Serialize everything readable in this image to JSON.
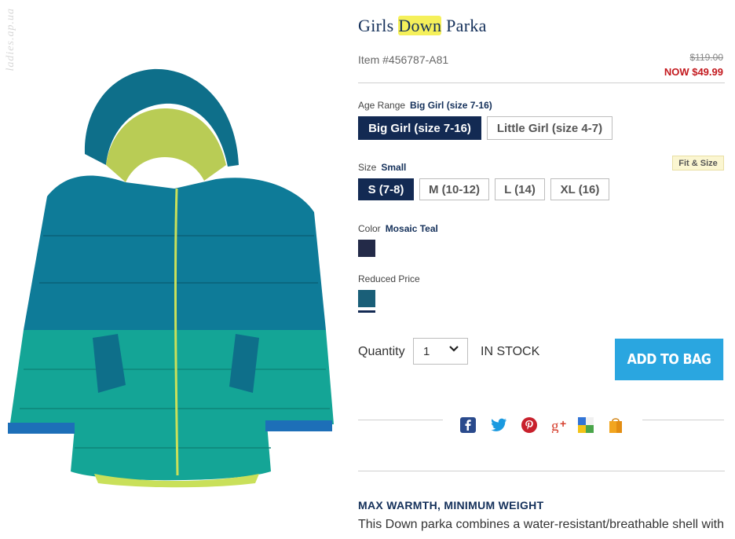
{
  "watermark": "ladies.ap.ua",
  "product": {
    "title_pre": "Girls ",
    "title_hl": "Down",
    "title_post": " Parka",
    "item_number": "Item #456787-A81",
    "price_old": "$119.00",
    "price_now": "NOW $49.99"
  },
  "age_range": {
    "label": "Age Range",
    "selected": "Big Girl (size 7-16)",
    "options": [
      "Big Girl (size 7-16)",
      "Little Girl (size 4-7)"
    ]
  },
  "size": {
    "label": "Size",
    "selected": "Small",
    "options": [
      "S (7-8)",
      "M (10-12)",
      "L (14)",
      "XL (16)"
    ],
    "fit_link": "Fit & Size"
  },
  "color": {
    "label": "Color",
    "selected": "Mosaic Teal",
    "swatch_color": "#232a48",
    "reduced_label": "Reduced Price",
    "reduced_swatch_color": "#1a5f78"
  },
  "quantity": {
    "label": "Quantity",
    "value": "1",
    "stock": "IN STOCK"
  },
  "add_to_bag": "ADD TO BAG",
  "description": {
    "heading": "MAX WARMTH, MINIMUM WEIGHT",
    "text": "This Down parka combines a water-resistant/breathable shell with"
  },
  "colors": {
    "navy": "#132a53",
    "accent": "#2aa6e0",
    "sale_red": "#c3191e"
  }
}
